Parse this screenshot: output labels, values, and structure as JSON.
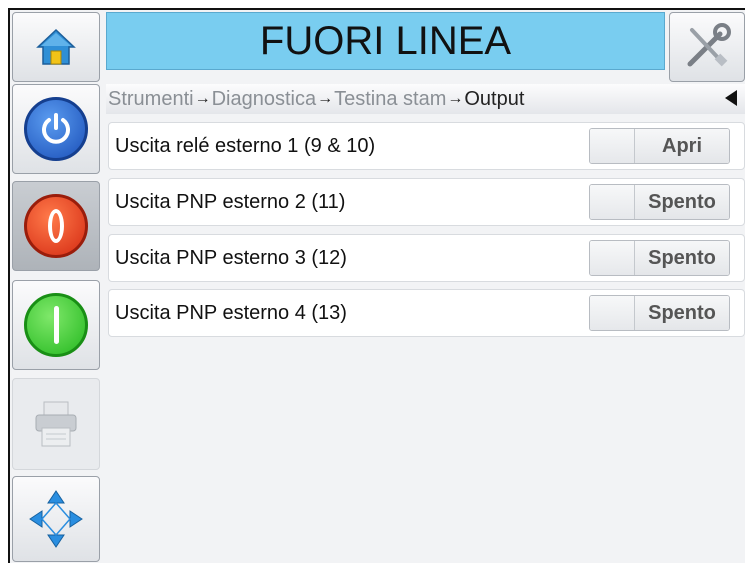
{
  "status_text": "FUORI LINEA",
  "breadcrumb": {
    "items": [
      "Strumenti",
      "Diagnostica",
      "Testina stam",
      "Output"
    ],
    "separator": "→"
  },
  "outputs": [
    {
      "label": "Uscita relé esterno 1 (9 & 10)",
      "state": "Apri"
    },
    {
      "label": "Uscita PNP esterno 2 (11)",
      "state": "Spento"
    },
    {
      "label": "Uscita PNP esterno 3 (12)",
      "state": "Spento"
    },
    {
      "label": "Uscita PNP esterno 4 (13)",
      "state": "Spento"
    }
  ],
  "colors": {
    "status_bg": "#79cdf0",
    "power_blue": "#1a5fcf",
    "stop_red": "#e0361c",
    "start_green": "#2fc42a"
  },
  "icons": [
    "home-icon",
    "tools-icon",
    "power-icon",
    "stop-icon",
    "start-icon",
    "printer-icon",
    "navigation-arrows-icon",
    "back-arrow-icon"
  ]
}
